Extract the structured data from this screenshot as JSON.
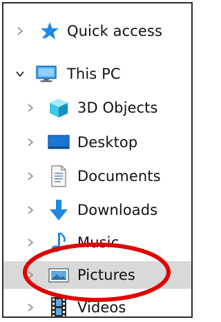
{
  "nav_tree": {
    "items": [
      {
        "label": "Quick access",
        "icon": "star-pin-icon",
        "expanded": false
      },
      {
        "label": "This PC",
        "icon": "computer-icon",
        "expanded": true
      },
      {
        "label": "3D Objects",
        "icon": "3d-objects-icon",
        "expanded": false
      },
      {
        "label": "Desktop",
        "icon": "desktop-icon",
        "expanded": false
      },
      {
        "label": "Documents",
        "icon": "documents-icon",
        "expanded": false
      },
      {
        "label": "Downloads",
        "icon": "downloads-icon",
        "expanded": false
      },
      {
        "label": "Music",
        "icon": "music-icon",
        "expanded": false
      },
      {
        "label": "Pictures",
        "icon": "pictures-icon",
        "expanded": false,
        "selected": true
      },
      {
        "label": "Videos",
        "icon": "videos-icon",
        "expanded": false
      }
    ]
  },
  "annotation": {
    "shape": "ellipse",
    "target": "Pictures",
    "color": "#e00000"
  },
  "colors": {
    "selection_background": "#d9d9d9",
    "chevron": "#8a8a8a",
    "accent_blue": "#1e88e5"
  }
}
